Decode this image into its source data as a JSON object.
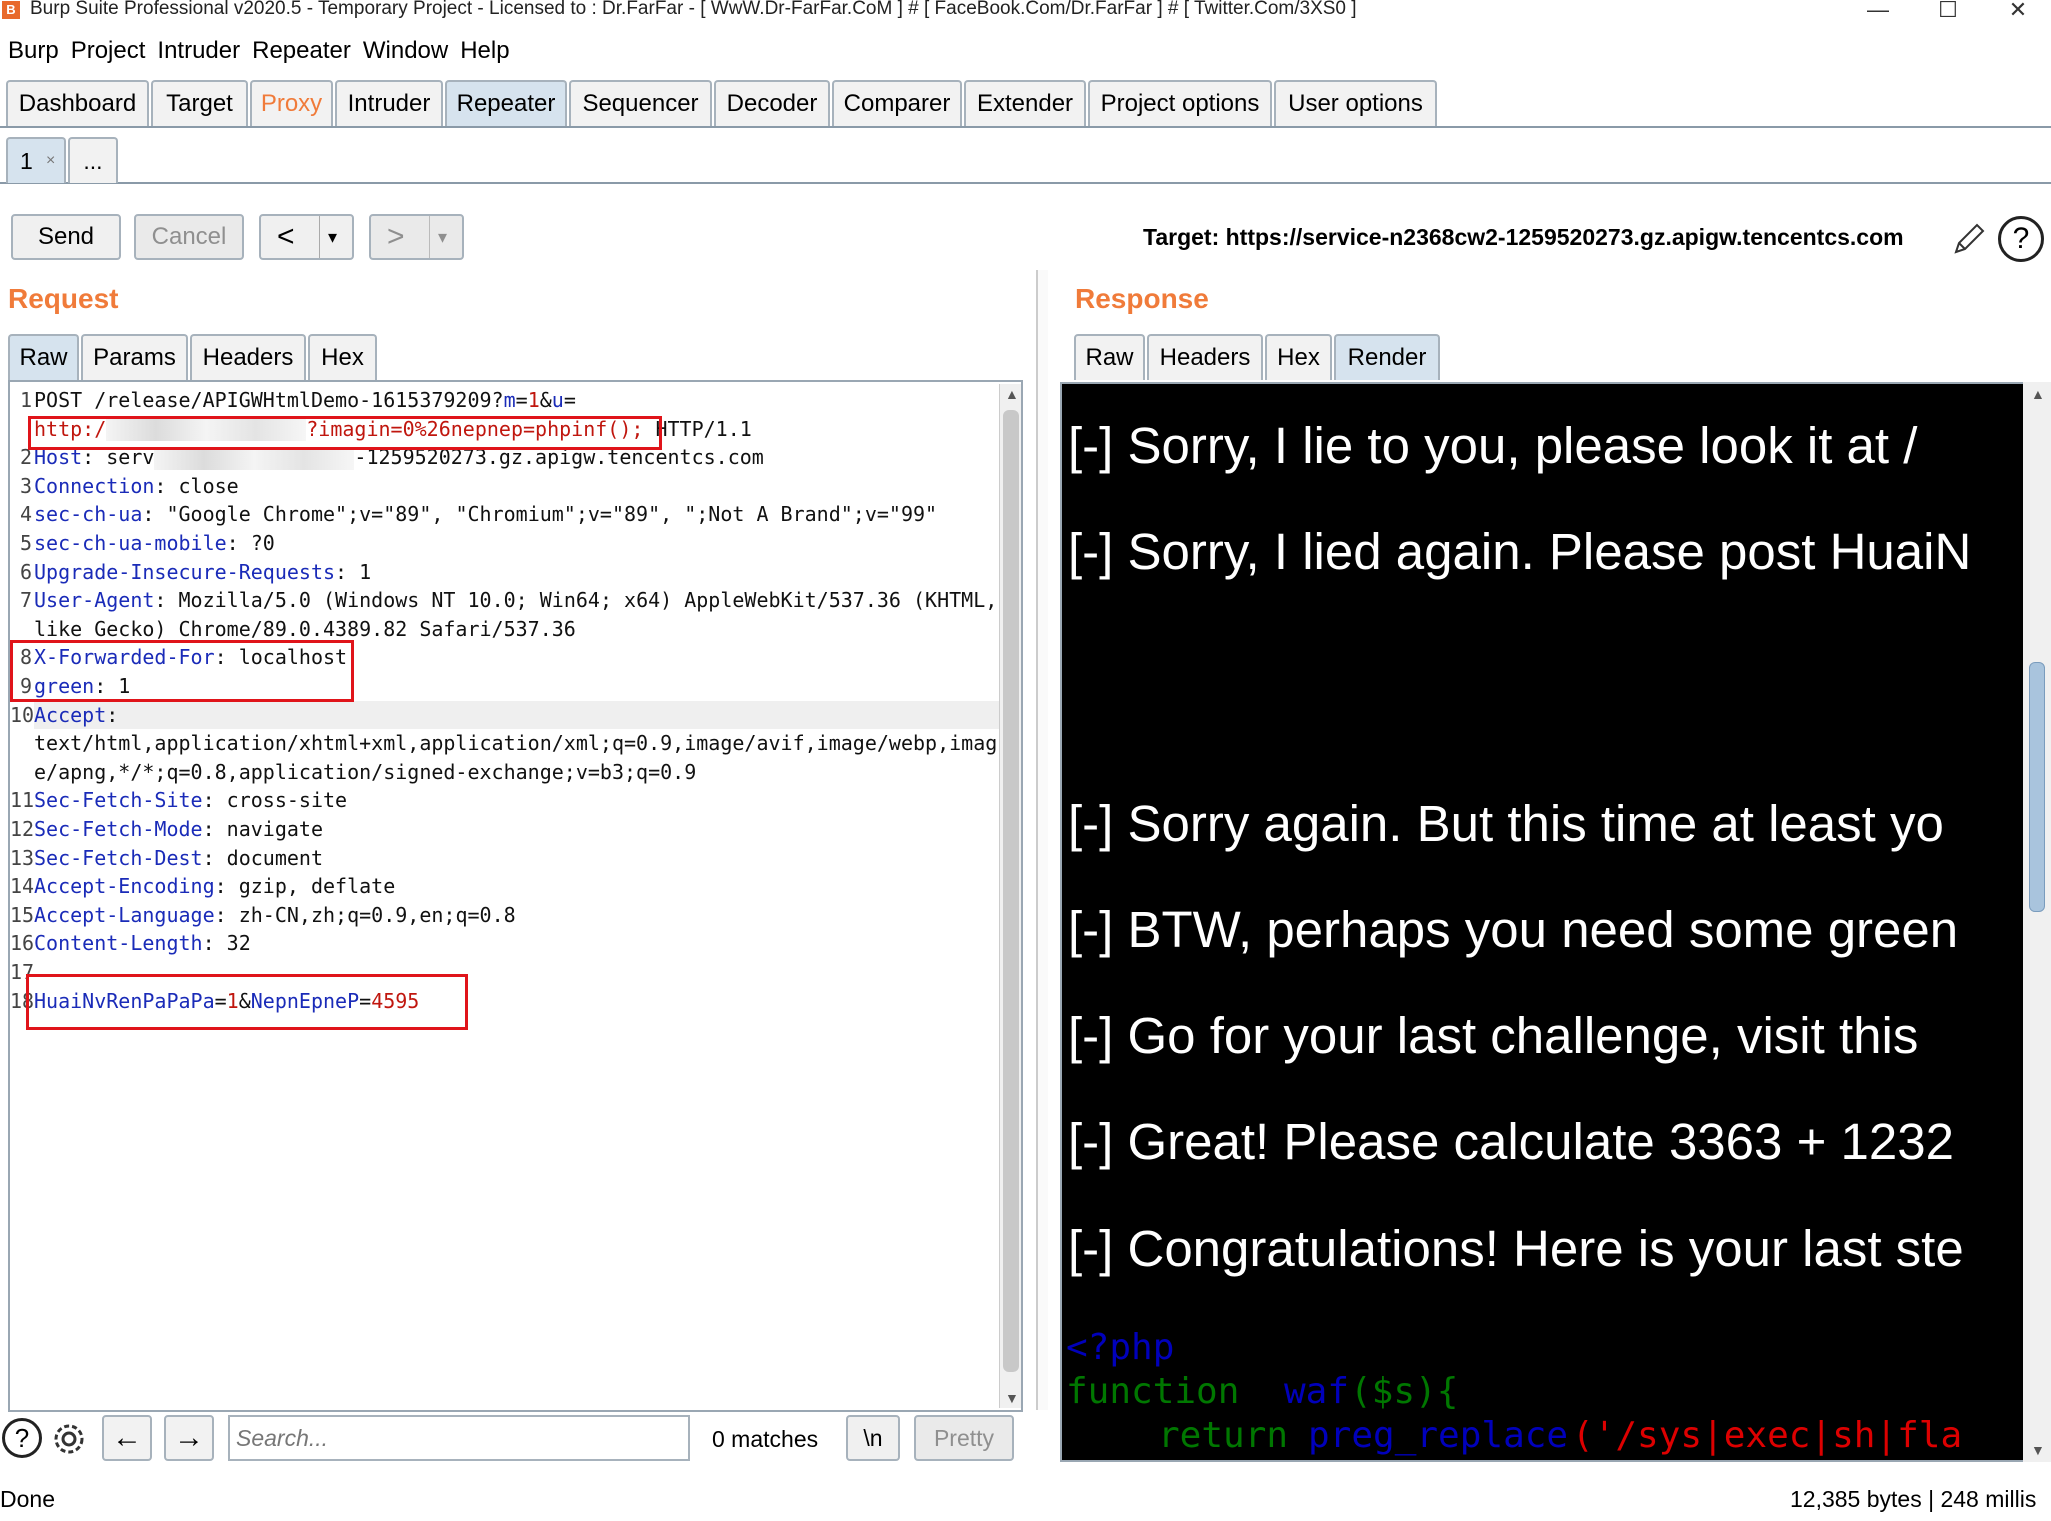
{
  "titlebar": {
    "title": "Burp Suite Professional v2020.5 - Temporary Project - Licensed to : Dr.FarFar - [ WwW.Dr-FarFar.CoM ] # [ FaceBook.Com/Dr.FarFar ] # [ Twitter.Com/3XS0 ]"
  },
  "menu": [
    "Burp",
    "Project",
    "Intruder",
    "Repeater",
    "Window",
    "Help"
  ],
  "main_tabs": [
    "Dashboard",
    "Target",
    "Proxy",
    "Intruder",
    "Repeater",
    "Sequencer",
    "Decoder",
    "Comparer",
    "Extender",
    "Project options",
    "User options"
  ],
  "sub_tabs": {
    "tab1": "1",
    "tab1_close": "×",
    "more": "..."
  },
  "toolbar": {
    "send": "Send",
    "cancel": "Cancel",
    "back": "<",
    "forward": ">",
    "dropdown": "▾"
  },
  "target": {
    "label": "Target: https://service-n2368cw2-1259520273.gz.apigw.tencentcs.com"
  },
  "request": {
    "title": "Request",
    "tabs": [
      "Raw",
      "Params",
      "Headers",
      "Hex"
    ],
    "lines": [
      {
        "n": "1",
        "parts": [
          {
            "t": "POST /re"
          },
          {
            "t": "lease/APIGWHtmlDemo-1615379209?"
          },
          {
            "t": "m",
            "c": "k"
          },
          {
            "t": "="
          },
          {
            "t": "1",
            "c": "rd"
          },
          {
            "t": "&"
          },
          {
            "t": "u",
            "c": "k"
          },
          {
            "t": "="
          }
        ]
      },
      {
        "n": "",
        "parts": [
          {
            "t": "http:/",
            "c": "rd"
          },
          {
            "t": "",
            "blur": true
          },
          {
            "t": "?imagin=0%26nepnep=phpinf();",
            "c": "rd"
          },
          {
            "t": " HTTP/1.1"
          }
        ]
      },
      {
        "n": "2",
        "parts": [
          {
            "t": "Host",
            "c": "k"
          },
          {
            "t": ": serv"
          },
          {
            "t": "",
            "blur": true
          },
          {
            "t": "-1259520273.gz.apigw.tencentcs.com"
          }
        ]
      },
      {
        "n": "3",
        "parts": [
          {
            "t": "Connection",
            "c": "k"
          },
          {
            "t": ": close"
          }
        ]
      },
      {
        "n": "4",
        "parts": [
          {
            "t": "sec-ch-ua",
            "c": "k"
          },
          {
            "t": ": \"Google Chrome\";v=\"89\", \"Chromium\";v=\"89\", \";Not A Brand\";v=\"99\""
          }
        ]
      },
      {
        "n": "5",
        "parts": [
          {
            "t": "sec-ch-ua-mobile",
            "c": "k"
          },
          {
            "t": ": ?0"
          }
        ]
      },
      {
        "n": "6",
        "parts": [
          {
            "t": "Upgrade-Insecure-Requests",
            "c": "k"
          },
          {
            "t": ": 1"
          }
        ]
      },
      {
        "n": "7",
        "parts": [
          {
            "t": "User-Agent",
            "c": "k"
          },
          {
            "t": ": Mozilla/5.0 (Windows NT 10.0; Win64; x64) AppleWebKit/537.36 (KHTML,"
          }
        ]
      },
      {
        "n": "",
        "parts": [
          {
            "t": "like Gecko) Chrome/89.0.4389.82 Safari/537.36"
          }
        ]
      },
      {
        "n": "8",
        "parts": [
          {
            "t": "X-Forwarded-For",
            "c": "k"
          },
          {
            "t": ": localhost"
          }
        ]
      },
      {
        "n": "9",
        "parts": [
          {
            "t": "green",
            "c": "k"
          },
          {
            "t": ": 1"
          }
        ]
      },
      {
        "n": "10",
        "parts": [
          {
            "t": "Accept",
            "c": "k"
          },
          {
            "t": ":"
          }
        ],
        "hl": true
      },
      {
        "n": "",
        "parts": [
          {
            "t": "text/html,application/xhtml+xml,application/xml;q=0.9,image/avif,image/webp,imag"
          }
        ]
      },
      {
        "n": "",
        "parts": [
          {
            "t": "e/apng,*/*;q=0.8,application/signed-exchange;v=b3;q=0.9"
          }
        ]
      },
      {
        "n": "11",
        "parts": [
          {
            "t": "Sec-Fetch-Site",
            "c": "k"
          },
          {
            "t": ": cross-site"
          }
        ]
      },
      {
        "n": "12",
        "parts": [
          {
            "t": "Sec-Fetch-Mode",
            "c": "k"
          },
          {
            "t": ": navigate"
          }
        ]
      },
      {
        "n": "13",
        "parts": [
          {
            "t": "Sec-Fetch-Dest",
            "c": "k"
          },
          {
            "t": ": document"
          }
        ]
      },
      {
        "n": "14",
        "parts": [
          {
            "t": "Accept-Encoding",
            "c": "k"
          },
          {
            "t": ": gzip, deflate"
          }
        ]
      },
      {
        "n": "15",
        "parts": [
          {
            "t": "Accept-Language",
            "c": "k"
          },
          {
            "t": ": zh-CN,zh;q=0.9,en;q=0.8"
          }
        ]
      },
      {
        "n": "16",
        "parts": [
          {
            "t": "Content-Length",
            "c": "k"
          },
          {
            "t": ": 32"
          }
        ]
      },
      {
        "n": "17",
        "parts": []
      },
      {
        "n": "18",
        "parts": [
          {
            "t": "HuaiNvRenPaPaPa",
            "c": "k"
          },
          {
            "t": "="
          },
          {
            "t": "1",
            "c": "rd"
          },
          {
            "t": "&"
          },
          {
            "t": "NepnEpneP",
            "c": "k"
          },
          {
            "t": "="
          },
          {
            "t": "4595",
            "c": "rd"
          }
        ]
      }
    ]
  },
  "response": {
    "title": "Response",
    "tabs": [
      "Raw",
      "Headers",
      "Hex",
      "Render"
    ],
    "lines": [
      "[-] Sorry, I lie to you, please look it at /",
      "[-] Sorry, I lied again. Please post HuaiN",
      "[-] Sorry again. But this time at least yo",
      "[-] BTW, perhaps you need some green",
      "[-] Go for your last challenge, visit this",
      "[-] Great! Please calculate 3363 + 1232",
      "[-] Congratulations! Here is your last ste"
    ],
    "php": {
      "open": "<?php",
      "fn_kw": "function",
      "fn_name": "waf",
      "fn_args": "($s){",
      "ret": "return",
      "call": "preg_replace",
      "arg": "('/sys|exec|sh|fla"
    }
  },
  "bottom": {
    "search_placeholder": "Search...",
    "matches": "0 matches",
    "newline": "\\n",
    "pretty": "Pretty"
  },
  "status": {
    "left": "Done",
    "right": "12,385 bytes | 248 millis"
  },
  "colors": {
    "accent": "#f07b3a",
    "keyword": "#1a2bb8",
    "value": "#c0160e",
    "highlight": "#e0141a"
  }
}
